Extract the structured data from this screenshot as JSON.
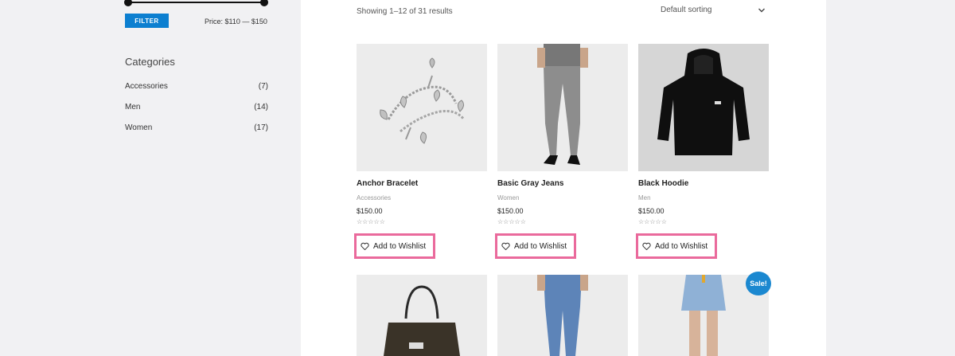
{
  "sidebar": {
    "filter_label": "FILTER",
    "price_text": "Price: $110 — $150",
    "categories_heading": "Categories",
    "categories": [
      {
        "name": "Accessories",
        "count": "(7)"
      },
      {
        "name": "Men",
        "count": "(14)"
      },
      {
        "name": "Women",
        "count": "(17)"
      }
    ]
  },
  "toolbar": {
    "results_text": "Showing 1–12 of 31 results",
    "sorting_label": "Default sorting"
  },
  "products": [
    {
      "name": "Anchor Bracelet",
      "category": "Accessories",
      "price": "$150.00",
      "stars": "☆☆☆☆☆",
      "wishlist": "Add to Wishlist"
    },
    {
      "name": "Basic Gray Jeans",
      "category": "Women",
      "price": "$150.00",
      "stars": "☆☆☆☆☆",
      "wishlist": "Add to Wishlist"
    },
    {
      "name": "Black Hoodie",
      "category": "Men",
      "price": "$150.00",
      "stars": "☆☆☆☆☆",
      "wishlist": "Add to Wishlist"
    }
  ],
  "sale_badge": "Sale!",
  "colors": {
    "accent": "#0c7fd0",
    "highlight": "#ea6a9c",
    "sale": "#1b88d0"
  }
}
